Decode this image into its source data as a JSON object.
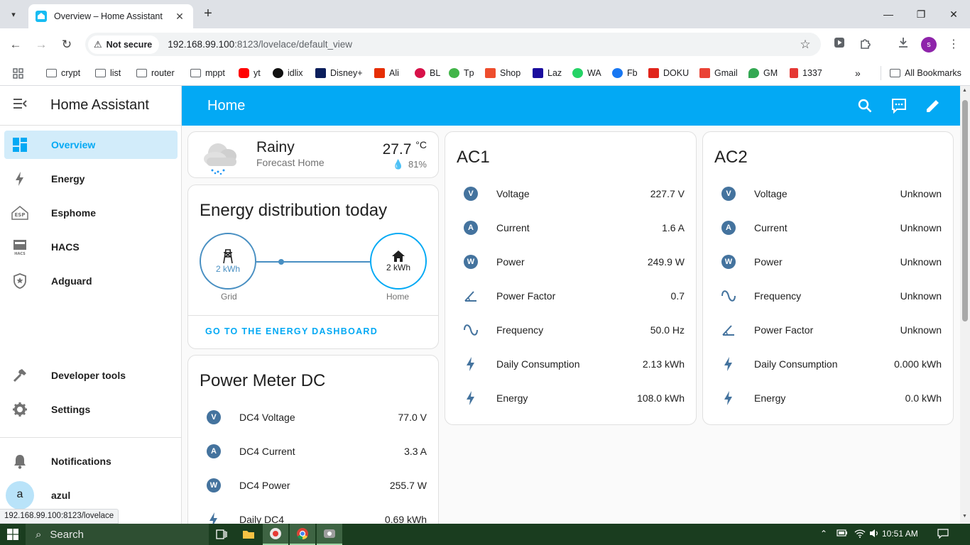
{
  "browser": {
    "tab_title": "Overview – Home Assistant",
    "not_secure_label": "Not secure",
    "url_host": "192.168.99.100",
    "url_rest": ":8123/lovelace/default_view",
    "bookmarks": [
      "crypt",
      "list",
      "router",
      "mppt",
      "yt",
      "idlix",
      "Disney+",
      "Ali",
      "BL",
      "Tp",
      "Shop",
      "Laz",
      "WA",
      "Fb",
      "DOKU",
      "Gmail",
      "GM",
      "1337"
    ],
    "all_bookmarks_label": "All Bookmarks",
    "profile_initial": "s",
    "status_url": "192.168.99.100:8123/lovelace"
  },
  "sidebar": {
    "title": "Home Assistant",
    "items": [
      {
        "label": "Overview",
        "icon": "view-dashboard-icon"
      },
      {
        "label": "Energy",
        "icon": "lightning-bolt-icon"
      },
      {
        "label": "Esphome",
        "icon": "esphome-icon"
      },
      {
        "label": "HACS",
        "icon": "hacs-icon"
      },
      {
        "label": "Adguard",
        "icon": "shield-star-icon"
      }
    ],
    "developer_tools": "Developer tools",
    "settings": "Settings",
    "notifications": "Notifications",
    "user_initial": "a",
    "user_name": "azul"
  },
  "header": {
    "title": "Home",
    "accent": "#03a9f4"
  },
  "weather": {
    "condition": "Rainy",
    "source": "Forecast Home",
    "temperature": "27.7",
    "unit": "°C",
    "humidity": "81%"
  },
  "energy": {
    "title": "Energy distribution today",
    "grid_value": "2 kWh",
    "grid_label": "Grid",
    "home_value": "2 kWh",
    "home_label": "Home",
    "link": "GO TO THE ENERGY DASHBOARD"
  },
  "dc": {
    "title": "Power Meter DC",
    "rows": [
      {
        "name": "DC4 Voltage",
        "value": "77.0 V",
        "icon": "V"
      },
      {
        "name": "DC4 Current",
        "value": "3.3 A",
        "icon": "A"
      },
      {
        "name": "DC4 Power",
        "value": "255.7 W",
        "icon": "W"
      },
      {
        "name": "Daily DC4",
        "value": "0.69 kWh",
        "icon": "bolt"
      }
    ]
  },
  "ac1": {
    "title": "AC1",
    "rows": [
      {
        "name": "Voltage",
        "value": "227.7 V",
        "icon": "V"
      },
      {
        "name": "Current",
        "value": "1.6 A",
        "icon": "A"
      },
      {
        "name": "Power",
        "value": "249.9 W",
        "icon": "W"
      },
      {
        "name": "Power Factor",
        "value": "0.7",
        "icon": "angle"
      },
      {
        "name": "Frequency",
        "value": "50.0 Hz",
        "icon": "sine"
      },
      {
        "name": "Daily Consumption",
        "value": "2.13 kWh",
        "icon": "bolt"
      },
      {
        "name": "Energy",
        "value": "108.0 kWh",
        "icon": "bolt"
      }
    ]
  },
  "ac2": {
    "title": "AC2",
    "rows": [
      {
        "name": "Voltage",
        "value": "Unknown",
        "icon": "V"
      },
      {
        "name": "Current",
        "value": "Unknown",
        "icon": "A"
      },
      {
        "name": "Power",
        "value": "Unknown",
        "icon": "W"
      },
      {
        "name": "Frequency",
        "value": "Unknown",
        "icon": "sine"
      },
      {
        "name": "Power Factor",
        "value": "Unknown",
        "icon": "angle"
      },
      {
        "name": "Daily Consumption",
        "value": "0.000 kWh",
        "icon": "bolt"
      },
      {
        "name": "Energy",
        "value": "0.0 kWh",
        "icon": "bolt"
      }
    ]
  },
  "taskbar": {
    "search_placeholder": "Search",
    "time": "10:51 AM"
  }
}
